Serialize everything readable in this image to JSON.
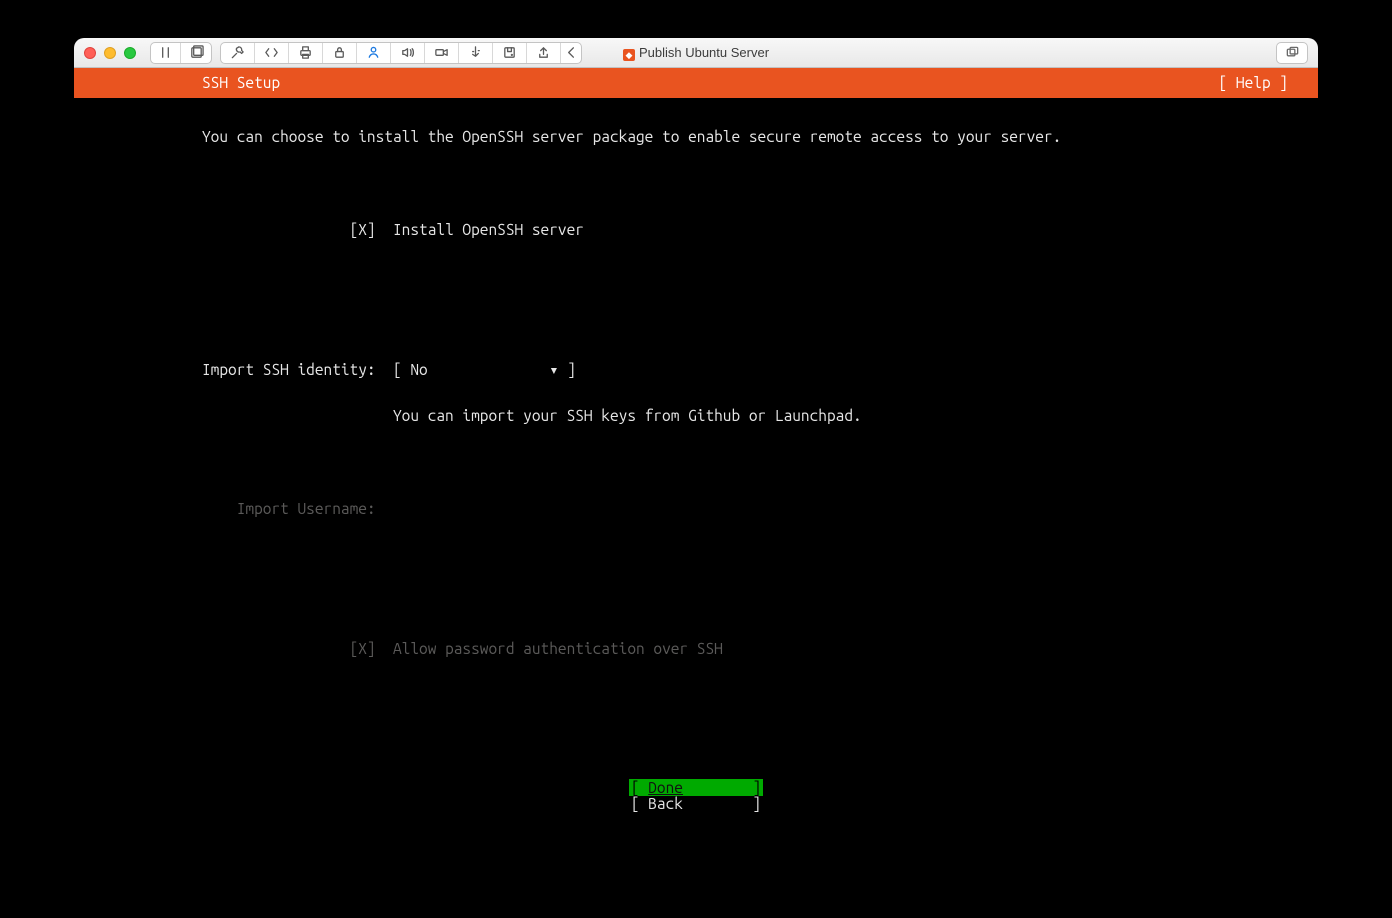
{
  "app": {
    "window_title": "Publish Ubuntu Server"
  },
  "installer": {
    "header": {
      "title": "SSH Setup",
      "help_label": "[ Help ]"
    },
    "description": "You can choose to install the OpenSSH server package to enable secure remote access to your server.",
    "install_option": {
      "mark": "[X]",
      "label": "Install OpenSSH server"
    },
    "import_identity": {
      "label": "Import SSH identity:",
      "open": "[",
      "value": "No",
      "arrow": "▾",
      "close": "]",
      "hint": "You can import your SSH keys from Github or Launchpad."
    },
    "import_username": {
      "label": "Import Username:"
    },
    "allow_password": {
      "mark": "[X]",
      "label": "Allow password authentication over SSH"
    },
    "footer": {
      "done_open": "[",
      "done_label": "Done",
      "done_pad": "        ",
      "done_close": "]",
      "back": "[ Back        ]"
    }
  }
}
